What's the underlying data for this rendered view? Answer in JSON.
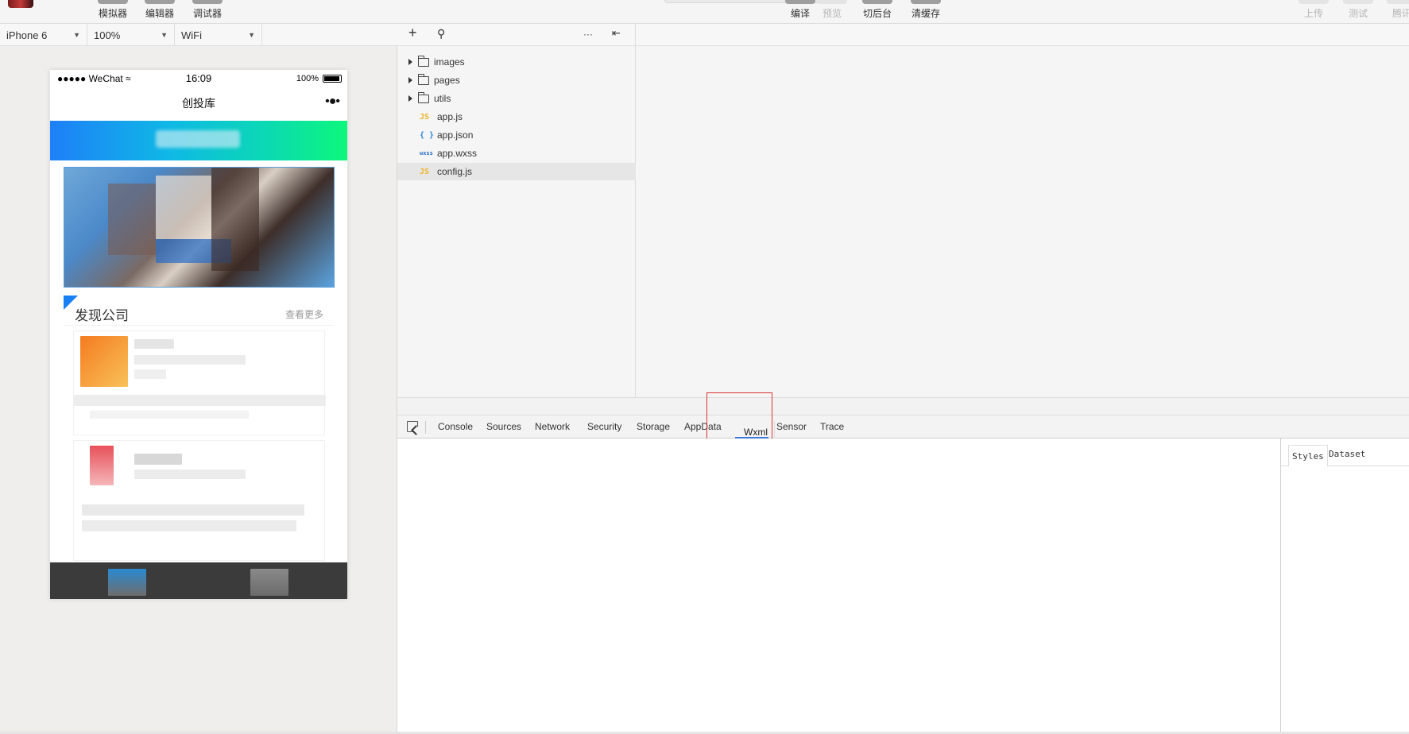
{
  "toolbar": {
    "simulator": "模拟器",
    "editor": "编辑器",
    "debugger": "调试器",
    "compile": "编译",
    "preview": "预览",
    "background": "切后台",
    "clear_cache": "清缓存",
    "upload": "上传",
    "test": "测试",
    "tencent": "腾讯"
  },
  "simulator_bar": {
    "device": "iPhone 6",
    "zoom": "100%",
    "network": "WiFi"
  },
  "phone": {
    "carrier": "●●●●● WeChat ≈",
    "time": "16:09",
    "battery_pct": "100%",
    "nav_title": "创投库",
    "nav_more": "•●•",
    "section_title": "发现公司",
    "section_more": "查看更多"
  },
  "file_tree": {
    "items": [
      {
        "type": "folder",
        "name": "images"
      },
      {
        "type": "folder",
        "name": "pages"
      },
      {
        "type": "folder",
        "name": "utils"
      },
      {
        "type": "js",
        "icon": "JS",
        "name": "app.js"
      },
      {
        "type": "json",
        "icon": "{ }",
        "name": "app.json"
      },
      {
        "type": "wxss",
        "icon": "wxss",
        "name": "app.wxss"
      },
      {
        "type": "js",
        "icon": "JS",
        "name": "config.js"
      }
    ]
  },
  "devtools": {
    "tabs": [
      "Console",
      "Sources",
      "Network",
      "Security",
      "Storage",
      "AppData",
      "Wxml",
      "Sensor",
      "Trace"
    ],
    "active_tab": "Wxml",
    "side_tabs": [
      "Styles",
      "Dataset"
    ]
  },
  "colors": {
    "accent_blue": "#1a7ff2",
    "tab_underline": "#3a7bd5",
    "highlight_box": "#dd3333"
  }
}
